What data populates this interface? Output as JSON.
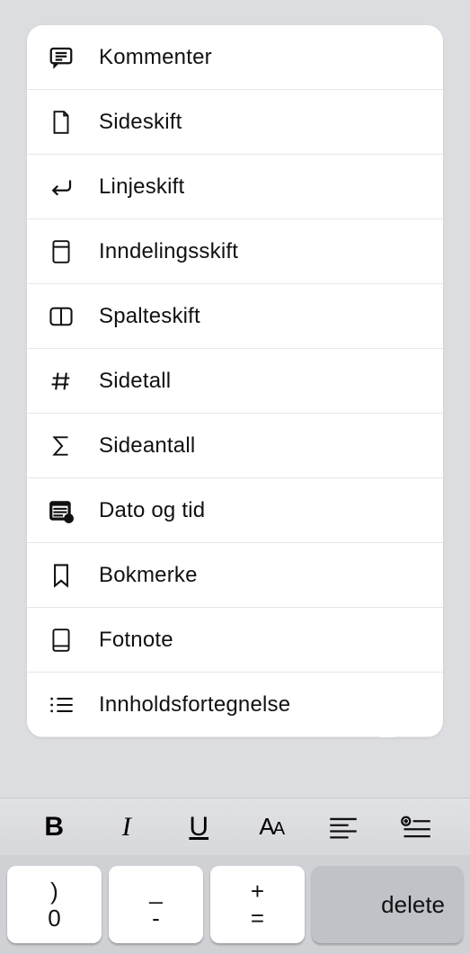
{
  "menu": {
    "items": [
      {
        "label": "Kommenter",
        "icon": "comment"
      },
      {
        "label": "Sideskift",
        "icon": "pagebreak"
      },
      {
        "label": "Linjeskift",
        "icon": "return"
      },
      {
        "label": "Inndelingsskift",
        "icon": "section"
      },
      {
        "label": "Spalteskift",
        "icon": "columns"
      },
      {
        "label": "Sidetall",
        "icon": "hash"
      },
      {
        "label": "Sideantall",
        "icon": "sigma"
      },
      {
        "label": "Dato og tid",
        "icon": "calendar"
      },
      {
        "label": "Bokmerke",
        "icon": "bookmark"
      },
      {
        "label": "Fotnote",
        "icon": "footnote"
      },
      {
        "label": "Innholdsfortegnelse",
        "icon": "toc"
      }
    ]
  },
  "toolbar": {
    "bold": "B",
    "italic": "I",
    "underline": "U"
  },
  "keyboard": {
    "keys": [
      {
        "top": ")",
        "bottom": "0"
      },
      {
        "top": "_",
        "bottom": "-"
      },
      {
        "top": "+",
        "bottom": "="
      }
    ],
    "delete": "delete"
  }
}
